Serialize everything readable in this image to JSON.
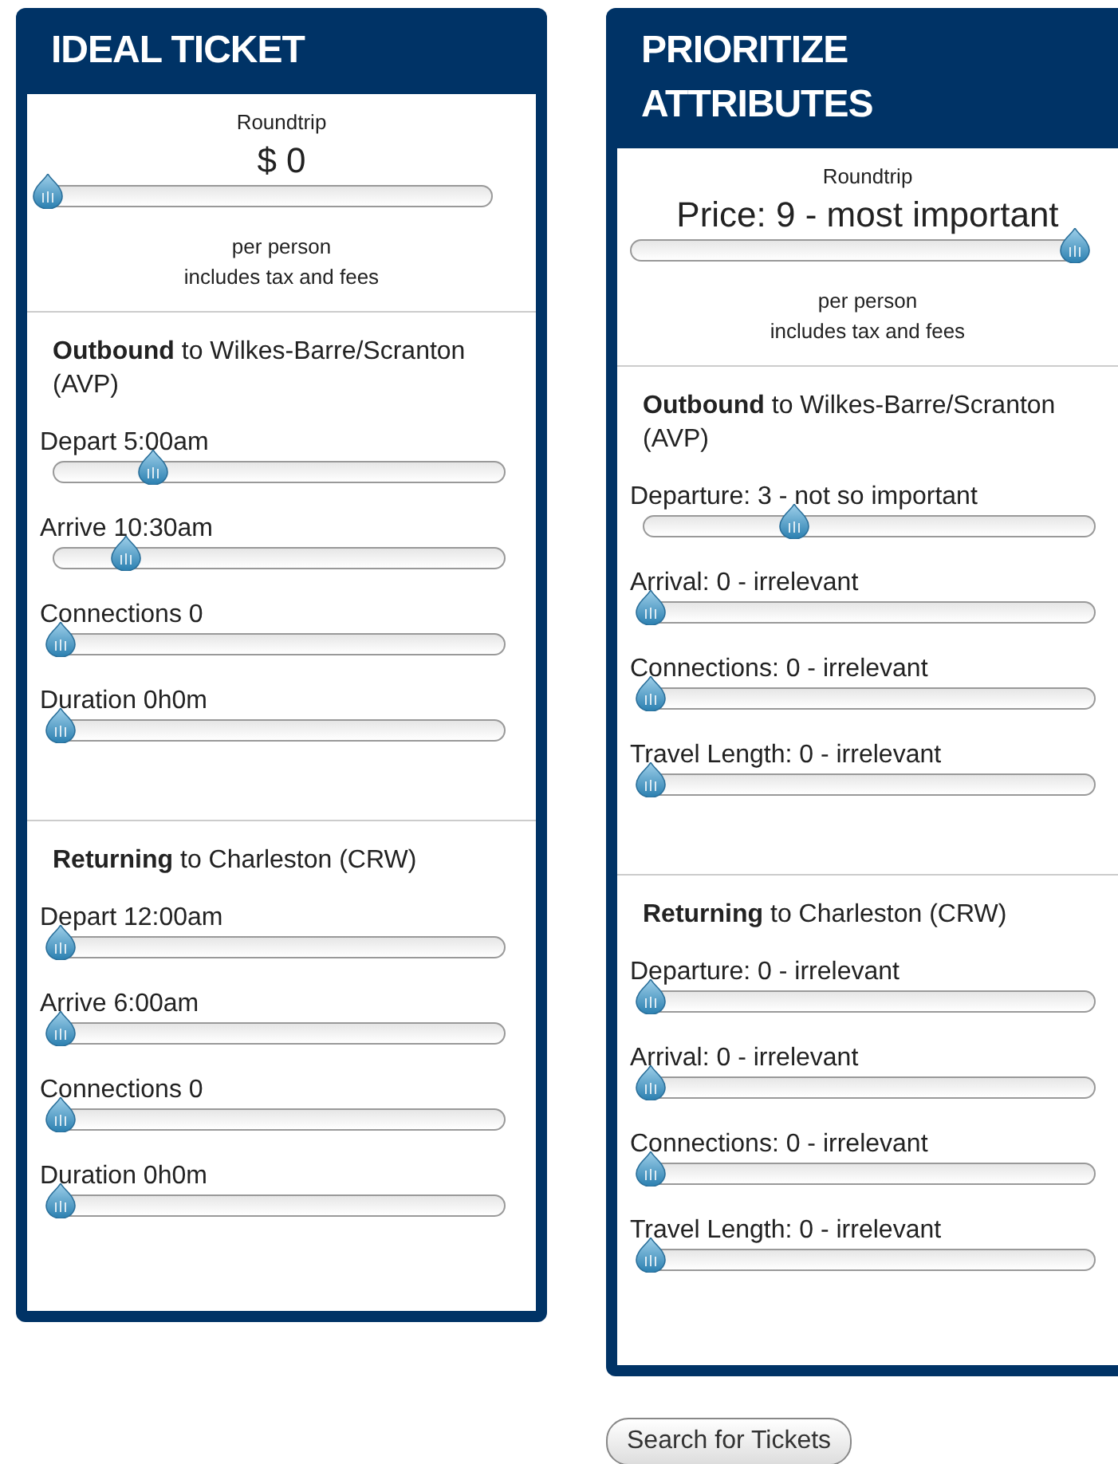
{
  "panels": [
    {
      "title": "IDEAL TICKET",
      "price": {
        "caption": "Roundtrip",
        "value": "$ 0",
        "level": 0,
        "notes": [
          "per person",
          "includes tax and fees"
        ]
      },
      "sections": [
        {
          "heading": "**Outbound** to Wilkes-Barre/Scranton (AVP)",
          "sliders": [
            {
              "label": "Depart 5:00am",
              "level": 0.21
            },
            {
              "label": "Arrive 10:30am",
              "level": 0.15
            },
            {
              "label": "Connections 0",
              "level": 0
            },
            {
              "label": "Duration 0h0m",
              "level": 0
            }
          ]
        },
        {
          "heading": "**Returning** to Charleston (CRW)",
          "sliders": [
            {
              "label": "Depart 12:00am",
              "level": 0
            },
            {
              "label": "Arrive 6:00am",
              "level": 0
            },
            {
              "label": "Connections 0",
              "level": 0
            },
            {
              "label": "Duration 0h0m",
              "level": 0
            }
          ]
        }
      ]
    },
    {
      "title": "PRIORITIZE ATTRIBUTES",
      "price": {
        "caption": "Roundtrip",
        "value": "Price: 9 - most important",
        "level": 1,
        "notes": [
          "per person",
          "includes tax and fees"
        ]
      },
      "sections": [
        {
          "heading": "**Outbound** to Wilkes-Barre/Scranton (AVP)",
          "sliders": [
            {
              "label": "Departure: 3 - not so important",
              "level": 0.33
            },
            {
              "label": "Arrival: 0 - irrelevant",
              "level": 0
            },
            {
              "label": "Connections: 0 - irrelevant",
              "level": 0
            },
            {
              "label": "Travel Length: 0 - irrelevant",
              "level": 0
            }
          ]
        },
        {
          "heading": "**Returning** to Charleston (CRW)",
          "sliders": [
            {
              "label": "Departure: 0 - irrelevant",
              "level": 0
            },
            {
              "label": "Arrival: 0 - irrelevant",
              "level": 0
            },
            {
              "label": "Connections: 0 - irrelevant",
              "level": 0
            },
            {
              "label": "Travel Length: 0 - irrelevant",
              "level": 0
            }
          ]
        }
      ]
    }
  ],
  "button": "Search for Tickets"
}
